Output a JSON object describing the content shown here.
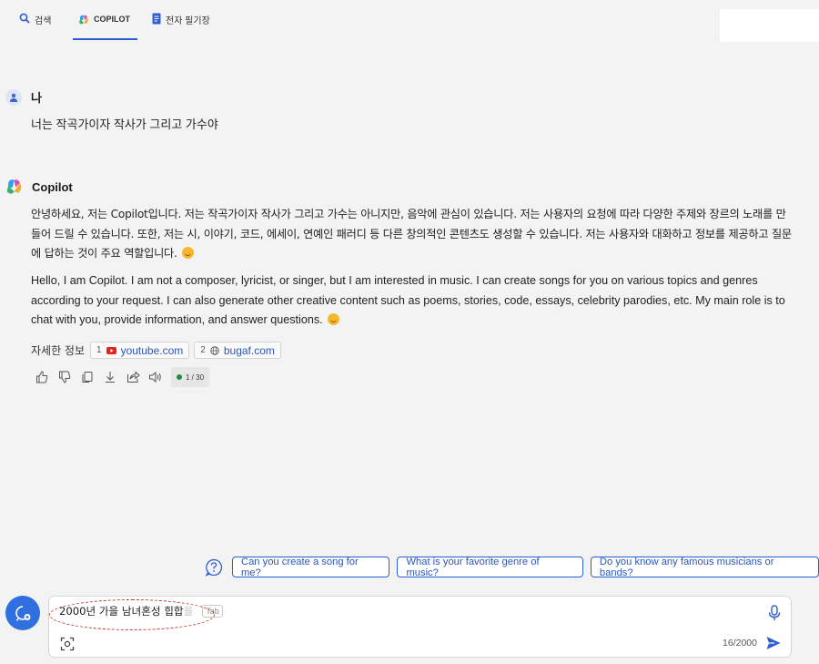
{
  "tabs": [
    {
      "label": "검색",
      "icon": "search-icon"
    },
    {
      "label": "COPILOT",
      "icon": "copilot-logo-icon",
      "active": true
    },
    {
      "label": "전자 필기장",
      "icon": "notebook-icon"
    }
  ],
  "user_message": {
    "author": "나",
    "text": "너는 작곡가이자 작사가 그리고 가수야"
  },
  "copilot_message": {
    "author": "Copilot",
    "korean_text": "안녕하세요, 저는 Copilot입니다. 저는 작곡가이자 작사가 그리고 가수는 아니지만, 음악에 관심이 있습니다. 저는 사용자의 요청에 따라 다양한 주제와 장르의 노래를 만들어 드릴 수 있습니다. 또한, 저는 시, 이야기, 코드, 에세이, 연예인 패러디 등 다른 창의적인 콘텐츠도 생성할 수 있습니다. 저는 사용자와 대화하고 정보를 제공하고 질문에 답하는 것이 주요 역할입니다.",
    "english_text": "Hello, I am Copilot. I am not a composer, lyricist, or singer, but I am interested in music. I can create songs for you on various topics and genres according to your request. I can also generate other creative content such as poems, stories, code, essays, celebrity parodies, etc. My main role is to chat with you, provide information, and answer questions.",
    "sources_label": "자세한 정보",
    "sources": [
      {
        "num": "1",
        "label": "youtube.com",
        "icon": "youtube-icon"
      },
      {
        "num": "2",
        "label": "bugaf.com",
        "icon": "globe-icon"
      }
    ],
    "turn_counter": "1 / 30"
  },
  "suggestions": [
    "Can you create a song for me?",
    "What is your favorite genre of music?",
    "Do you know any famous musicians or bands?"
  ],
  "composer": {
    "input_value": "2000년 가을 남녀혼성 힙합",
    "ghost_completion": "을",
    "tab_hint": "Tab",
    "char_count": "16/2000"
  },
  "colors": {
    "accent": "#2c5fd1",
    "background": "#f3f3f3",
    "annotation_oval": "#c0392b"
  }
}
